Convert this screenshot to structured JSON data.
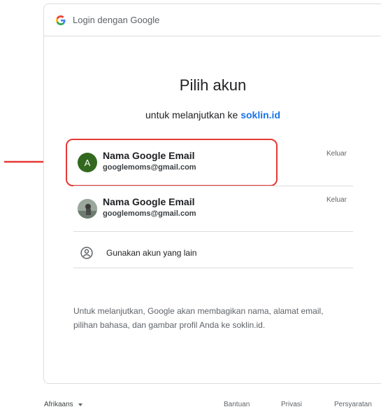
{
  "header": {
    "title": "Login dengan Google"
  },
  "main": {
    "title": "Pilih akun",
    "subtitle_prefix": "untuk melanjutkan ke",
    "subtitle_link": "soklin.id",
    "accounts": [
      {
        "avatar_letter": "A",
        "name": "Nama Google Email",
        "email": "googlemoms@gmail.com",
        "action": "Keluar"
      },
      {
        "avatar_letter": "",
        "name": "Nama Google Email",
        "email": "googlemoms@gmail.com",
        "action": "Keluar"
      }
    ],
    "other_account_label": "Gunakan akun yang lain",
    "info_text": "Untuk melanjutkan, Google akan membagikan nama, alamat email, pilihan bahasa, dan gambar profil Anda ke soklin.id."
  },
  "footer": {
    "language": "Afrikaans",
    "links": [
      "Bantuan",
      "Privasi",
      "Persyaratan"
    ]
  },
  "colors": {
    "link": "#1a73e8",
    "highlight": "#e53935",
    "avatar_a": "#33691e",
    "divider": "#dadce0"
  },
  "icons": {
    "google": "google-g-icon",
    "person": "account-circle-icon",
    "arrow": "red-arrow-icon",
    "caret": "caret-down-icon"
  }
}
